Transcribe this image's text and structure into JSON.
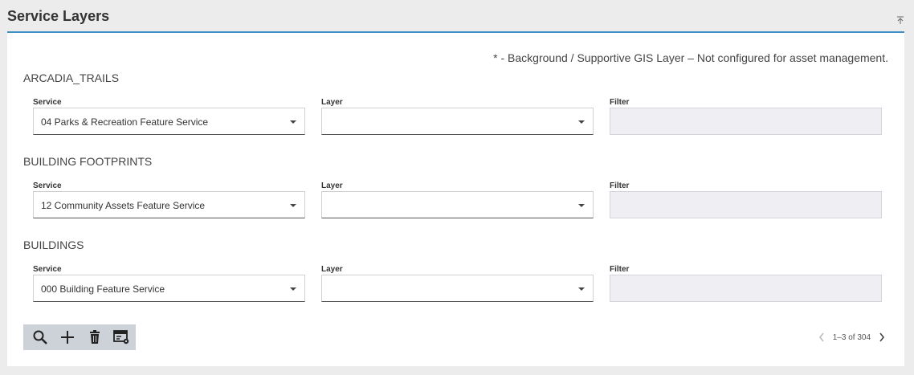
{
  "header": {
    "title": "Service Layers",
    "collapse_icon": "collapse-up-icon"
  },
  "legend_note": "* - Background / Supportive GIS Layer – Not configured for asset management.",
  "labels": {
    "service": "Service",
    "layer": "Layer",
    "filter": "Filter"
  },
  "layers": [
    {
      "name": "ARCADIA_TRAILS",
      "service": "04 Parks & Recreation Feature Service",
      "layer": "",
      "filter": ""
    },
    {
      "name": "BUILDING FOOTPRINTS",
      "service": "12 Community Assets Feature Service",
      "layer": "",
      "filter": ""
    },
    {
      "name": "BUILDINGS",
      "service": "000 Building Feature Service",
      "layer": "",
      "filter": ""
    }
  ],
  "toolbar": {
    "icons": [
      "search-icon",
      "add-icon",
      "delete-icon",
      "configure-service-icon"
    ]
  },
  "pagination": {
    "text": "1–3 of 304"
  },
  "colors": {
    "accent": "#3e8fc4",
    "toolbar_bg": "#cdd2d8",
    "filter_bg": "#eeeef3"
  }
}
